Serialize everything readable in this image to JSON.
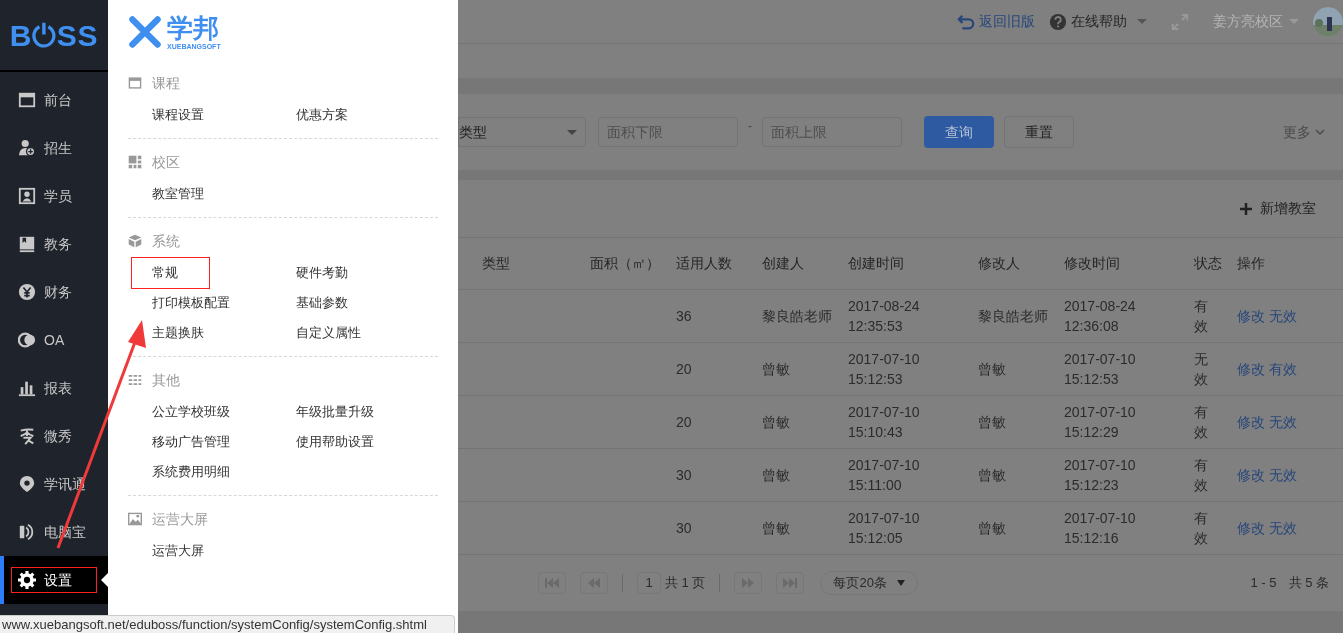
{
  "sidebar": {
    "logo": "B⏻SS",
    "items": [
      {
        "label": "前台",
        "selected": false,
        "highlighted": false
      },
      {
        "label": "招生",
        "selected": false,
        "highlighted": false
      },
      {
        "label": "学员",
        "selected": false,
        "highlighted": false
      },
      {
        "label": "教务",
        "selected": false,
        "highlighted": false
      },
      {
        "label": "财务",
        "selected": false,
        "highlighted": false
      },
      {
        "label": "OA",
        "selected": false,
        "highlighted": false
      },
      {
        "label": "报表",
        "selected": false,
        "highlighted": false
      },
      {
        "label": "微秀",
        "selected": false,
        "highlighted": false
      },
      {
        "label": "学讯通",
        "selected": false,
        "highlighted": false
      },
      {
        "label": "电脑宝",
        "selected": false,
        "highlighted": false
      },
      {
        "label": "设置",
        "selected": true,
        "highlighted": true
      }
    ]
  },
  "menu": {
    "logo": {
      "name": "学邦",
      "sub": "XUEBANGSOFT"
    },
    "sections": [
      {
        "title": "课程",
        "items": [
          {
            "label": "课程设置",
            "highlighted": false
          },
          {
            "label": "优惠方案",
            "highlighted": false
          }
        ]
      },
      {
        "title": "校区",
        "items": [
          {
            "label": "教室管理",
            "highlighted": false
          }
        ]
      },
      {
        "title": "系统",
        "items": [
          {
            "label": "常规",
            "highlighted": true
          },
          {
            "label": "硬件考勤",
            "highlighted": false
          },
          {
            "label": "打印模板配置",
            "highlighted": false
          },
          {
            "label": "基础参数",
            "highlighted": false
          },
          {
            "label": "主题换肤",
            "highlighted": false
          },
          {
            "label": "自定义属性",
            "highlighted": false
          }
        ]
      },
      {
        "title": "其他",
        "items": [
          {
            "label": "公立学校班级",
            "highlighted": false
          },
          {
            "label": "年级批量升级",
            "highlighted": false
          },
          {
            "label": "移动广告管理",
            "highlighted": false
          },
          {
            "label": "使用帮助设置",
            "highlighted": false
          },
          {
            "label": "系统费用明细",
            "highlighted": false
          }
        ]
      },
      {
        "title": "运营大屏",
        "items": [
          {
            "label": "运营大屏",
            "highlighted": false
          }
        ]
      }
    ]
  },
  "status_bar": "www.xuebangsoft.net/eduboss/function/systemConfig/systemConfig.shtml",
  "topbar": {
    "back": "返回旧版",
    "help": "在线帮助",
    "campus": "姜方亮校区"
  },
  "filters": {
    "type": "类型",
    "min_placeholder": "面积下限",
    "dash": "-",
    "max_placeholder": "面积上限",
    "search": "查询",
    "reset": "重置",
    "more": "更多"
  },
  "add_button": "新增教室",
  "table": {
    "columns": [
      "类型",
      "面积（㎡）",
      "适用人数",
      "创建人",
      "创建时间",
      "修改人",
      "修改时间",
      "状态",
      "操作"
    ],
    "rows": [
      {
        "cells": [
          "",
          "",
          "36",
          "黎良皓老师",
          "2017-08-24 12:35:53",
          "黎良皓老师",
          "2017-08-24 12:36:08",
          "有效"
        ],
        "actions": [
          "修改",
          "无效"
        ]
      },
      {
        "cells": [
          "",
          "",
          "20",
          "曾敏",
          "2017-07-10 15:12:53",
          "曾敏",
          "2017-07-10 15:12:53",
          "无效"
        ],
        "actions": [
          "修改",
          "有效"
        ]
      },
      {
        "cells": [
          "",
          "",
          "20",
          "曾敏",
          "2017-07-10 15:10:43",
          "曾敏",
          "2017-07-10 15:12:29",
          "有效"
        ],
        "actions": [
          "修改",
          "无效"
        ]
      },
      {
        "cells": [
          "",
          "",
          "30",
          "曾敏",
          "2017-07-10 15:11:00",
          "曾敏",
          "2017-07-10 15:12:23",
          "有效"
        ],
        "actions": [
          "修改",
          "无效"
        ]
      },
      {
        "cells": [
          "",
          "",
          "30",
          "曾敏",
          "2017-07-10 15:12:05",
          "曾敏",
          "2017-07-10 15:12:16",
          "有效"
        ],
        "actions": [
          "修改",
          "无效"
        ]
      }
    ]
  },
  "pagination": {
    "page": "1",
    "total_pages": "共 1 页",
    "page_size": "每页20条",
    "range": "1 - 5",
    "total": "共 5 条"
  }
}
